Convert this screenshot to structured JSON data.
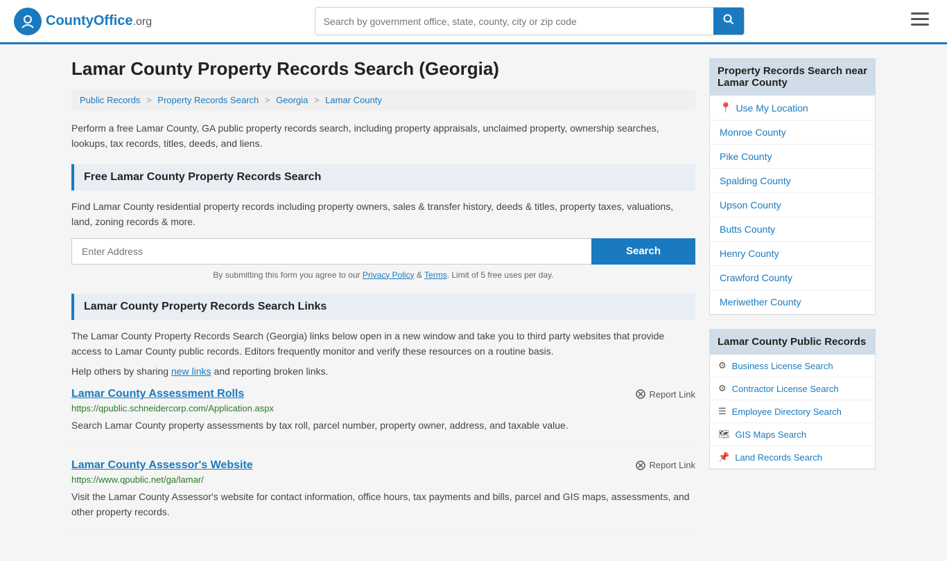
{
  "header": {
    "logo_text": "CountyOffice",
    "logo_suffix": ".org",
    "search_placeholder": "Search by government office, state, county, city or zip code",
    "search_btn_label": "🔍"
  },
  "page": {
    "title": "Lamar County Property Records Search (Georgia)",
    "breadcrumb": [
      {
        "label": "Public Records",
        "href": "#"
      },
      {
        "label": "Property Records Search",
        "href": "#"
      },
      {
        "label": "Georgia",
        "href": "#"
      },
      {
        "label": "Lamar County",
        "href": "#"
      }
    ],
    "description": "Perform a free Lamar County, GA public property records search, including property appraisals, unclaimed property, ownership searches, lookups, tax records, titles, deeds, and liens."
  },
  "free_search": {
    "title": "Free Lamar County Property Records Search",
    "description": "Find Lamar County residential property records including property owners, sales & transfer history, deeds & titles, property taxes, valuations, land, zoning records & more.",
    "input_placeholder": "Enter Address",
    "search_btn_label": "Search",
    "disclaimer": "By submitting this form you agree to our",
    "privacy_label": "Privacy Policy",
    "terms_label": "Terms",
    "limit_text": "Limit of 5 free uses per day."
  },
  "links_section": {
    "title": "Lamar County Property Records Search Links",
    "description": "The Lamar County Property Records Search (Georgia) links below open in a new window and take you to third party websites that provide access to Lamar County public records. Editors frequently monitor and verify these resources on a routine basis.",
    "share_text": "Help others by sharing",
    "share_link_label": "new links",
    "share_suffix": "and reporting broken links.",
    "links": [
      {
        "title": "Lamar County Assessment Rolls",
        "url": "https://qpublic.schneidercorp.com/Application.aspx",
        "description": "Search Lamar County property assessments by tax roll, parcel number, property owner, address, and taxable value.",
        "report_label": "Report Link"
      },
      {
        "title": "Lamar County Assessor's Website",
        "url": "https://www.qpublic.net/ga/lamar/",
        "description": "Visit the Lamar County Assessor's website for contact information, office hours, tax payments and bills, parcel and GIS maps, assessments, and other property records.",
        "report_label": "Report Link"
      }
    ]
  },
  "sidebar": {
    "nearby_title": "Property Records Search near Lamar County",
    "use_location_label": "Use My Location",
    "nearby_counties": [
      "Monroe County",
      "Pike County",
      "Spalding County",
      "Upson County",
      "Butts County",
      "Henry County",
      "Crawford County",
      "Meriwether County"
    ],
    "public_records_title": "Lamar County Public Records",
    "public_records_links": [
      {
        "label": "Business License Search",
        "icon": "⚙"
      },
      {
        "label": "Contractor License Search",
        "icon": "⚙"
      },
      {
        "label": "Employee Directory Search",
        "icon": "☰"
      },
      {
        "label": "GIS Maps Search",
        "icon": "🗺"
      },
      {
        "label": "Land Records Search",
        "icon": "📌"
      }
    ]
  }
}
